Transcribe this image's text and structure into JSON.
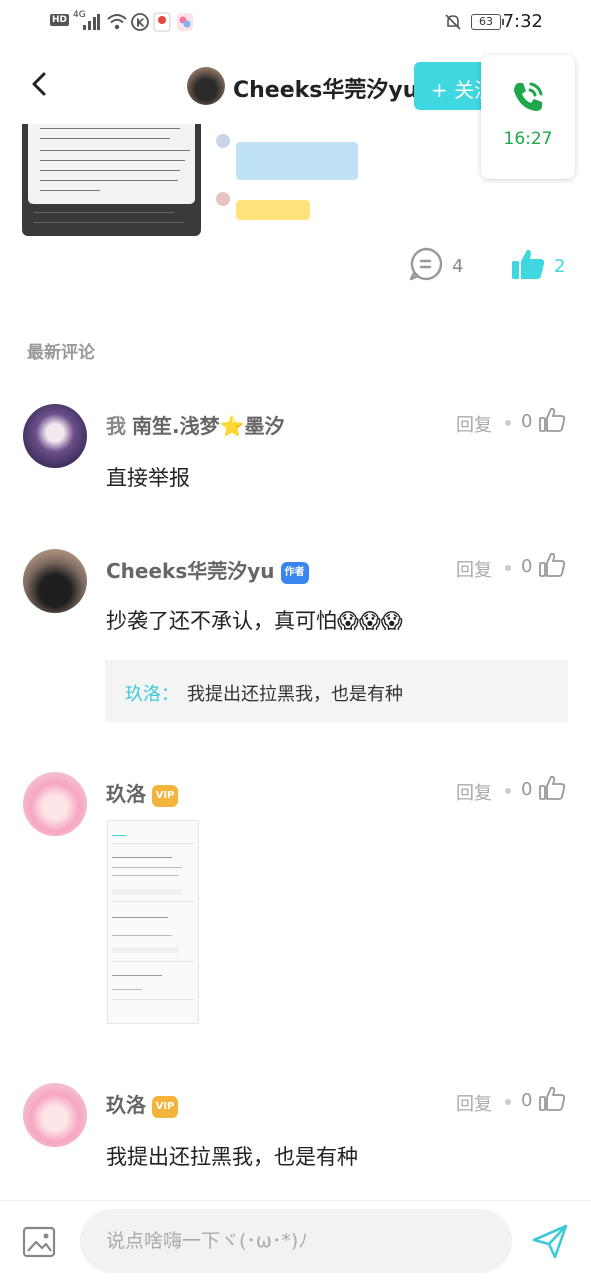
{
  "status_bar": {
    "hd": "HD",
    "network": "4G",
    "battery": "63",
    "time": "7:32"
  },
  "header": {
    "title": "Cheeks华莞汐yu",
    "follow_label": "+ 关注",
    "call_time": "16:27"
  },
  "post": {
    "comment_count": "4",
    "like_count": "2"
  },
  "section_title": "最新评论",
  "comments": [
    {
      "me_tag": "我",
      "name": "南笙.浅梦⭐墨汐",
      "text": "直接举报",
      "reply_label": "回复",
      "likes": "0"
    },
    {
      "name": "Cheeks华莞汐yu",
      "badge": "作者",
      "text": "抄袭了还不承认，真可怕😱😱😱",
      "reply_label": "回复",
      "likes": "0",
      "quote": {
        "name": "玖洛：",
        "text": "我提出还拉黑我，也是有种"
      }
    },
    {
      "name": "玖洛",
      "badge": "VIP",
      "text": "",
      "reply_label": "回复",
      "likes": "0"
    },
    {
      "name": "玖洛",
      "badge": "VIP",
      "text": "我提出还拉黑我，也是有种",
      "reply_label": "回复",
      "likes": "0"
    }
  ],
  "input": {
    "placeholder": "说点啥嗨一下ヾ(･ω･*)ﾉ"
  },
  "colors": {
    "accent": "#3fd7e0",
    "call_green": "#1fa84a",
    "author_badge": "#3a86f0",
    "vip_badge": "#f4b43c"
  }
}
